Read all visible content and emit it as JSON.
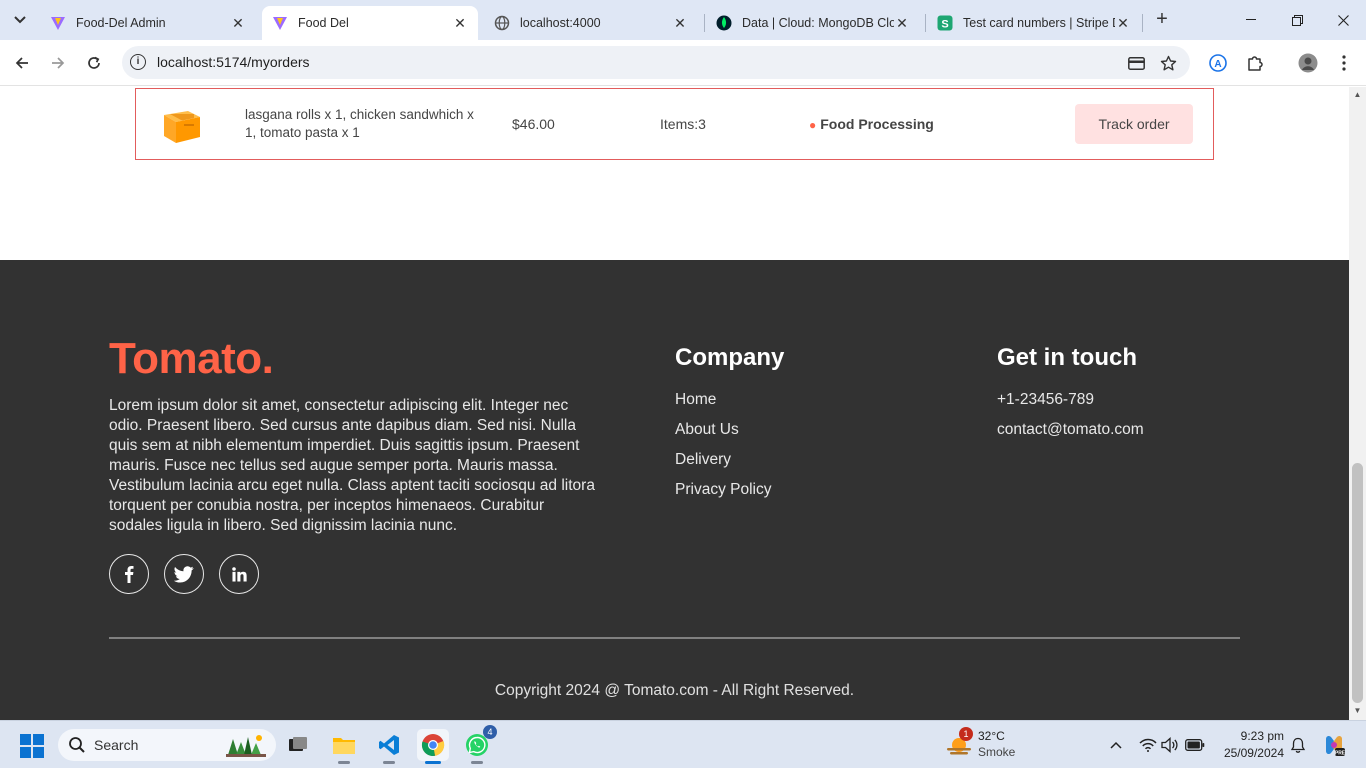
{
  "browser": {
    "tabs": [
      {
        "title": "Food-Del Admin",
        "icon": "vite-logo-icon",
        "active": false
      },
      {
        "title": "Food Del",
        "icon": "vite-logo-icon",
        "active": true
      },
      {
        "title": "localhost:4000",
        "icon": "globe-icon",
        "active": false
      },
      {
        "title": "Data | Cloud: MongoDB Clou",
        "icon": "mongodb-leaf-icon",
        "active": false
      },
      {
        "title": "Test card numbers | Stripe D",
        "icon": "stripe-icon",
        "active": false
      }
    ],
    "url": "localhost:5174/myorders"
  },
  "order": {
    "items": "lasgana rolls x 1, chicken sandwhich x 1, tomato pasta x 1",
    "amount": "$46.00",
    "count": "Items:3",
    "status_dot": "●",
    "status": "Food Processing",
    "track_label": "Track order"
  },
  "footer": {
    "logo": "Tomato.",
    "about": "Lorem ipsum dolor sit amet, consectetur adipiscing elit. Integer nec odio. Praesent libero. Sed cursus ante dapibus diam. Sed nisi. Nulla quis sem at nibh elementum imperdiet. Duis sagittis ipsum. Praesent mauris. Fusce nec tellus sed augue semper porta. Mauris massa. Vestibulum lacinia arcu eget nulla. Class aptent taciti sociosqu ad litora torquent per conubia nostra, per inceptos himenaeos. Curabitur sodales ligula in libero. Sed dignissim lacinia nunc.",
    "socials": [
      "facebook-icon",
      "twitter-icon",
      "linkedin-icon"
    ],
    "company": {
      "title": "Company",
      "links": [
        "Home",
        "About Us",
        "Delivery",
        "Privacy Policy"
      ]
    },
    "contact": {
      "title": "Get in touch",
      "phone": "+1-23456-789",
      "email": "contact@tomato.com"
    },
    "copyright": "Copyright 2024 @ Tomato.com - All Right Reserved."
  },
  "taskbar": {
    "search_label": "Search",
    "whatsapp_badge": "4",
    "weather": {
      "badge": "1",
      "temp": "32°C",
      "condition": "Smoke"
    },
    "time": "9:23 pm",
    "date": "25/09/2024"
  },
  "colors": {
    "accent": "#ff6347",
    "footer_bg": "#323232",
    "order_border": "#e25c5c",
    "track_btn_bg": "#ffe1e1"
  }
}
